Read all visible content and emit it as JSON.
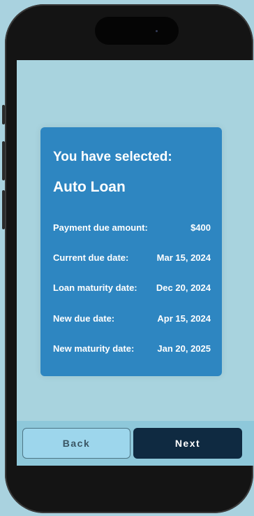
{
  "card": {
    "heading": "You have selected:",
    "loan_type": "Auto Loan",
    "rows": [
      {
        "label": "Payment due amount:",
        "value": "$400"
      },
      {
        "label": "Current due date:",
        "value": "Mar 15, 2024"
      },
      {
        "label": "Loan maturity date:",
        "value": "Dec 20, 2024"
      },
      {
        "label": "New due date:",
        "value": "Apr 15, 2024"
      },
      {
        "label": "New maturity date:",
        "value": "Jan 20, 2025"
      }
    ]
  },
  "actions": {
    "back_label": "Back",
    "next_label": "Next"
  },
  "colors": {
    "card": "#2e86c1",
    "next_button": "#0f2a41",
    "back_button": "#9dd6ec",
    "screen_background": "#a8d3de"
  }
}
